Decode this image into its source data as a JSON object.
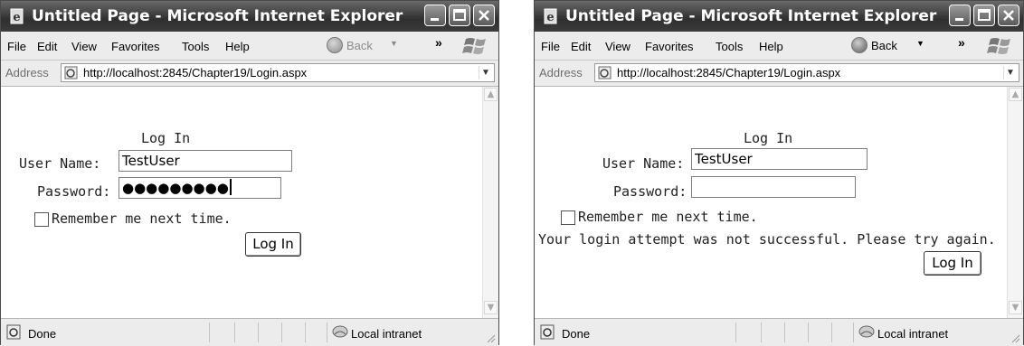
{
  "windows": [
    {
      "title": "Untitled Page - Microsoft Internet Explorer",
      "menu": [
        "File",
        "Edit",
        "View",
        "Favorites",
        "Tools",
        "Help"
      ],
      "back_label": "Back",
      "back_enabled": false,
      "chevron": "»",
      "address_label": "Address",
      "address_url": "http://localhost:2845/Chapter19/Login.aspx",
      "status_text": "Done",
      "zone_text": "Local intranet",
      "form": {
        "heading": "Log In",
        "username_label": "User Name:",
        "username_value": "TestUser",
        "password_label": "Password:",
        "password_value": "●●●●●●●●●",
        "remember_label": "Remember me next time.",
        "remember_checked": false,
        "error_text": "",
        "submit_label": "Log In"
      }
    },
    {
      "title": "Untitled Page - Microsoft Internet Explorer",
      "menu": [
        "File",
        "Edit",
        "View",
        "Favorites",
        "Tools",
        "Help"
      ],
      "back_label": "Back",
      "back_enabled": true,
      "chevron": "»",
      "address_label": "Address",
      "address_url": "http://localhost:2845/Chapter19/Login.aspx",
      "status_text": "Done",
      "zone_text": "Local intranet",
      "form": {
        "heading": "Log In",
        "username_label": "User Name:",
        "username_value": "TestUser",
        "password_label": "Password:",
        "password_value": "",
        "remember_label": "Remember me next time.",
        "remember_checked": false,
        "error_text": "Your login attempt was not successful. Please try again.",
        "submit_label": "Log In"
      }
    }
  ],
  "colors": {
    "titlebar_dark": "#2f2f2f",
    "chrome": "#ececec",
    "content": "#ffffff"
  }
}
